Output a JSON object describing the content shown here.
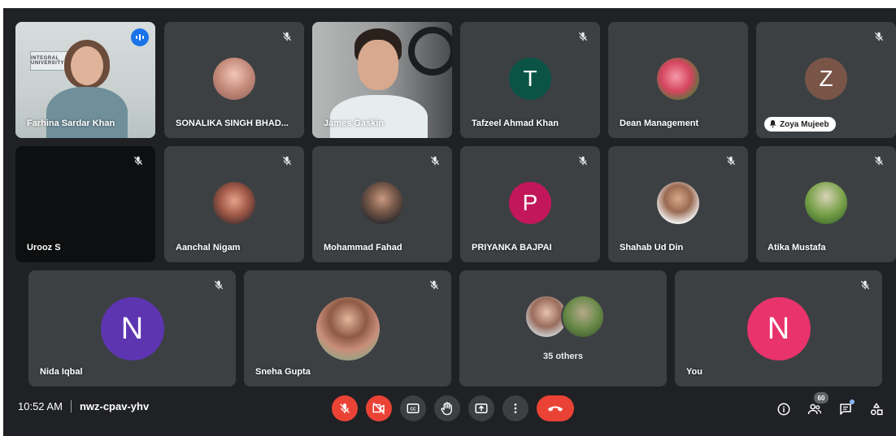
{
  "colors": {
    "tile_bg": "#3c4043",
    "stage_bg": "#202124",
    "active_border": "#8ab4f8",
    "end_call": "#ea4335",
    "speaking_blue": "#1a73e8"
  },
  "participants": [
    {
      "name": "Farhina Sardar Khan",
      "avatar": "video-feed",
      "muted": false,
      "speaking": true,
      "video_logo_text": "INTEGRAL UNIVERSITY"
    },
    {
      "name": "SONALIKA SINGH BHAD...",
      "avatar": "photo",
      "muted": true
    },
    {
      "name": "James Gaskin",
      "avatar": "video-feed",
      "muted": false
    },
    {
      "name": "Tafzeel Ahmad Khan",
      "avatar": "letter",
      "letter": "T",
      "color": "#0b5345",
      "muted": true
    },
    {
      "name": "Dean Management",
      "avatar": "photo",
      "muted": false
    },
    {
      "name": "Zoya Mujeeb",
      "avatar": "letter",
      "letter": "Z",
      "color": "#795548",
      "muted": true,
      "name_style": "chip"
    },
    {
      "name": "Urooz S",
      "avatar": "video-off",
      "muted": true
    },
    {
      "name": "Aanchal Nigam",
      "avatar": "photo",
      "muted": true
    },
    {
      "name": "Mohammad Fahad",
      "avatar": "photo",
      "muted": true
    },
    {
      "name": "PRIYANKA BAJPAI",
      "avatar": "letter",
      "letter": "P",
      "color": "#c2185b",
      "muted": true
    },
    {
      "name": "Shahab Ud Din",
      "avatar": "photo",
      "muted": true
    },
    {
      "name": "Atika Mustafa",
      "avatar": "photo",
      "muted": true
    },
    {
      "name": "Nida Iqbal",
      "avatar": "letter",
      "letter": "N",
      "color": "#5e35b1",
      "muted": true
    },
    {
      "name": "Sneha Gupta",
      "avatar": "photo",
      "muted": true
    },
    {
      "name": "You",
      "avatar": "letter",
      "letter": "N",
      "color": "#e8336d",
      "muted": true
    }
  ],
  "others": {
    "label": "35 others"
  },
  "meeting": {
    "time": "10:52 AM",
    "code": "nwz-cpav-yhv"
  },
  "controls": [
    {
      "name": "mic-off",
      "icon": "mic-off-icon",
      "state": "off"
    },
    {
      "name": "camera-off",
      "icon": "videocam-off-icon",
      "state": "off"
    },
    {
      "name": "captions",
      "icon": "closed-captions-icon"
    },
    {
      "name": "raise-hand",
      "icon": "hand-icon"
    },
    {
      "name": "present",
      "icon": "present-screen-icon"
    },
    {
      "name": "more",
      "icon": "more-vert-icon"
    },
    {
      "name": "leave-call",
      "icon": "call-end-icon"
    }
  ],
  "right_controls": {
    "info": "info-icon",
    "people": "people-icon",
    "people_count": "60",
    "chat": "chat-icon",
    "activities": "activities-icon"
  }
}
